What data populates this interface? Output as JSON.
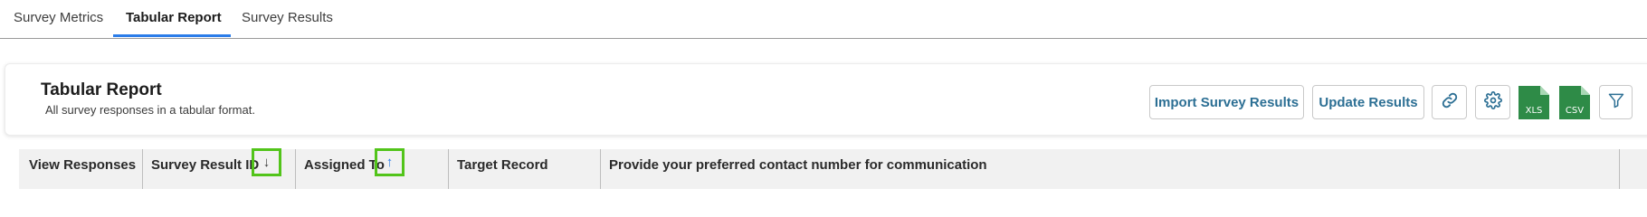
{
  "tabs": [
    {
      "label": "Survey Metrics",
      "active": false
    },
    {
      "label": "Tabular Report",
      "active": true
    },
    {
      "label": "Survey Results",
      "active": false
    }
  ],
  "header": {
    "title": "Tabular Report",
    "subtitle": "All survey responses in a tabular format."
  },
  "actions": {
    "import_label": "Import Survey Results",
    "update_label": "Update Results",
    "xls_label": "XLS",
    "csv_label": "CSV",
    "icons": [
      "link-icon",
      "gear-icon",
      "xls-file-icon",
      "csv-file-icon",
      "filter-icon"
    ]
  },
  "table": {
    "columns": [
      {
        "label": "View Responses"
      },
      {
        "label": "Survey Result ID",
        "sort": "descending",
        "sort_glyph": "↓"
      },
      {
        "label": "Assigned To",
        "sort": "ascending",
        "sort_glyph": "↑"
      },
      {
        "label": "Target Record"
      },
      {
        "label": "Provide your preferred contact number for communication"
      }
    ]
  },
  "colors": {
    "accent": "#2b7de9",
    "button_text": "#2c6f94",
    "file_green": "#2e8b47",
    "highlight": "#52c41a",
    "header_bg": "#f1f1f1"
  }
}
